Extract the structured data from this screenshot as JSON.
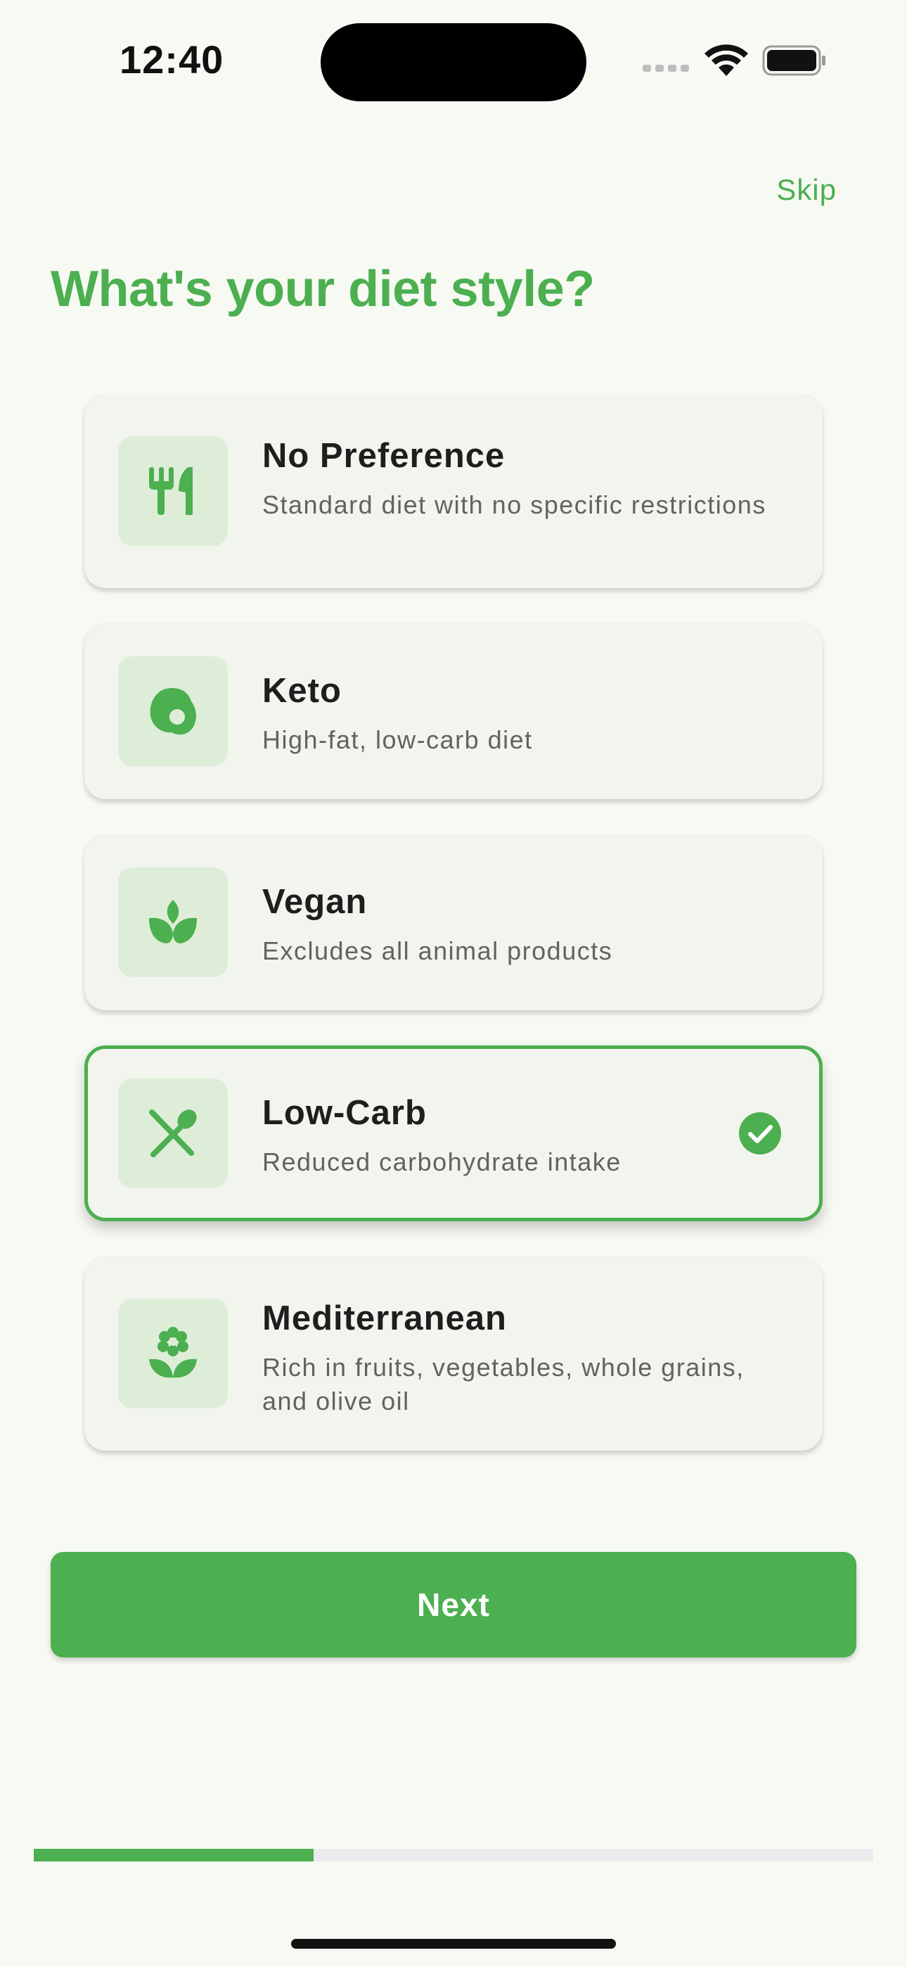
{
  "status_bar": {
    "time": "12:40"
  },
  "header": {
    "skip_label": "Skip"
  },
  "title": "What's your diet style?",
  "options": [
    {
      "title": "No Preference",
      "description": "Standard diet with no specific restrictions",
      "icon": "utensils-icon",
      "selected": false
    },
    {
      "title": "Keto",
      "description": "High-fat, low-carb diet",
      "icon": "egg-icon",
      "selected": false
    },
    {
      "title": "Vegan",
      "description": "Excludes all animal products",
      "icon": "sprout-icon",
      "selected": false
    },
    {
      "title": "Low-Carb",
      "description": "Reduced carbohydrate intake",
      "icon": "no-meal-icon",
      "selected": true
    },
    {
      "title": "Mediterranean",
      "description": "Rich in fruits, vegetables, whole grains, and olive oil",
      "icon": "flower-icon",
      "selected": false
    }
  ],
  "next_label": "Next",
  "progress": {
    "fraction": 0.333
  },
  "colors": {
    "accent": "#4CAF50",
    "background": "#F7FAF3",
    "card": "#F2F5EE",
    "icon_bg": "#DEEDD8"
  }
}
